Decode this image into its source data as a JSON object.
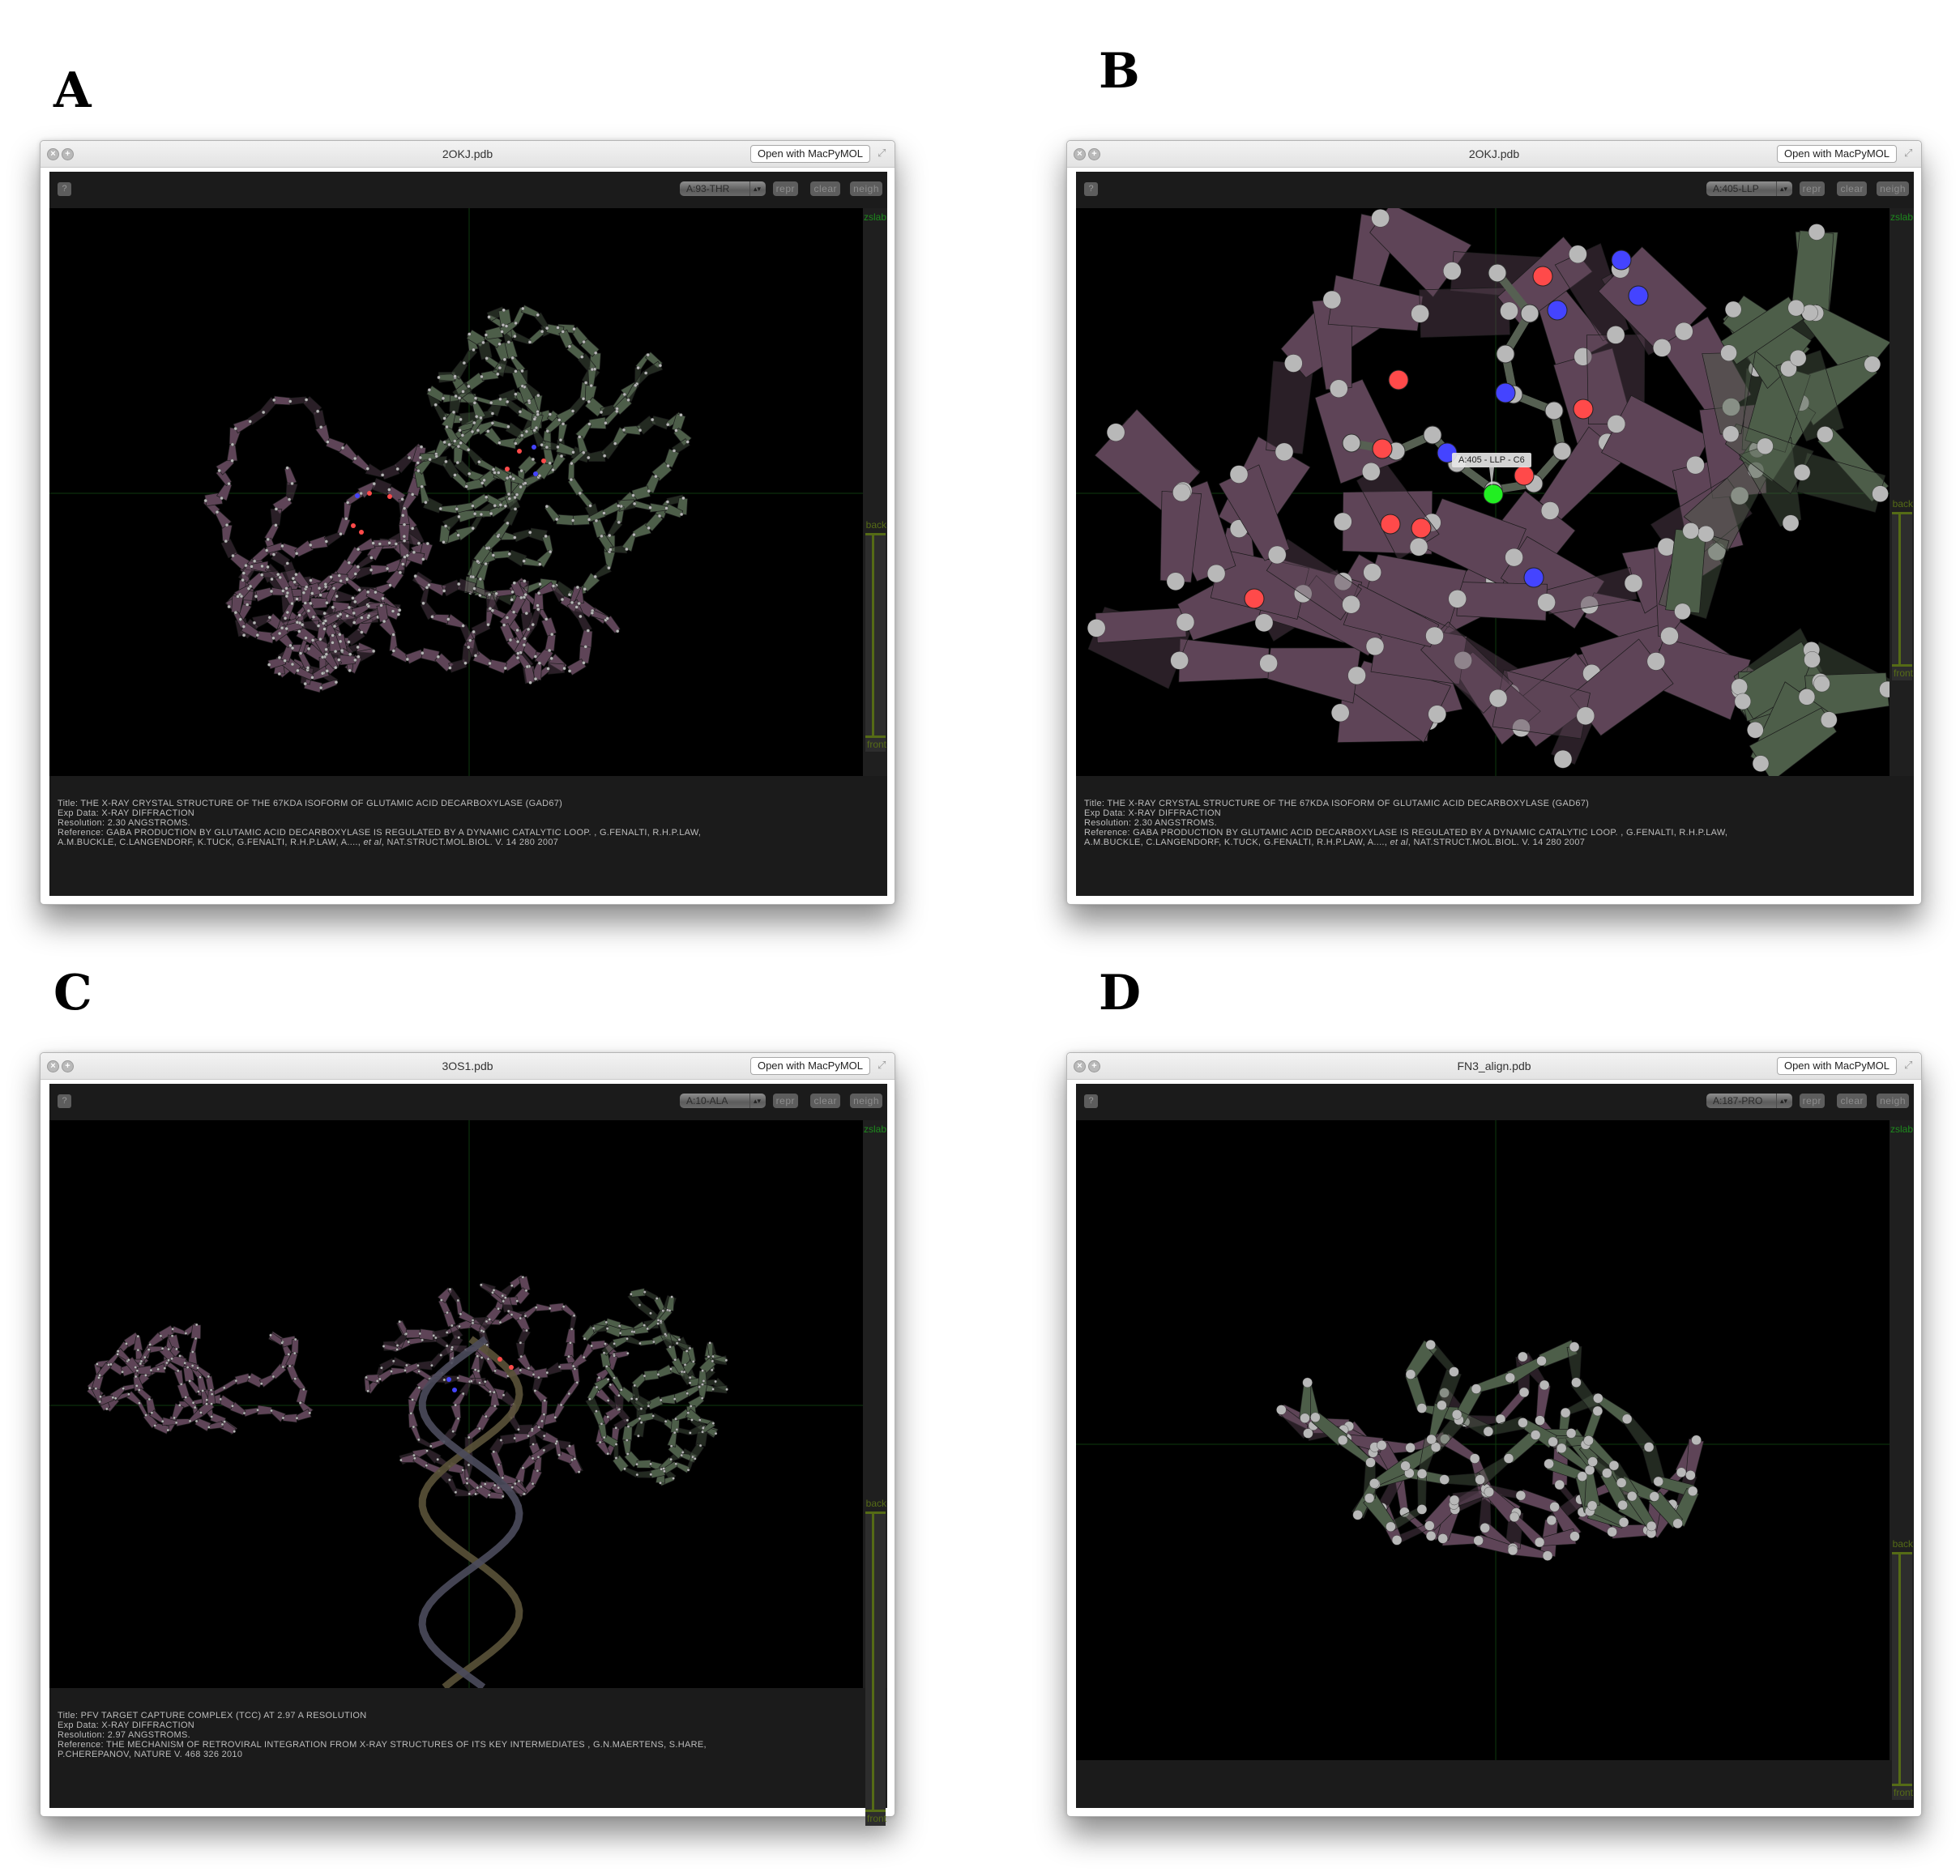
{
  "figure_labels": [
    "A",
    "B",
    "C",
    "D"
  ],
  "colors": {
    "chain_a": "#5e4457",
    "chain_b": "#4d5e49",
    "dna_strand_1": "#5a5238",
    "dna_strand_2": "#4b4b5c",
    "carbon": "#b8b8b8",
    "oxygen": "#ff4a4a",
    "nitrogen": "#4444ff",
    "selected_atom": "#22ee22",
    "zslab_label": "#1d8a1d",
    "zslab_bar": "#556b16"
  },
  "common": {
    "open_button": "Open with MacPyMOL",
    "help_button": "?",
    "repr_button": "repr",
    "clear_button": "clear",
    "neigh_button": "neigh",
    "zslab_label": "zslab",
    "back_label": "back",
    "front_label": "front",
    "close_icon": "×",
    "zoom_icon": "+",
    "expand_icon": "⤢",
    "select_arrows": "▴▾"
  },
  "panels": [
    {
      "label": "A",
      "window_title": "2OKJ.pdb",
      "residue_select": "A:93-THR",
      "view": "full-structure",
      "info": {
        "title": "Title: THE X-RAY CRYSTAL STRUCTURE OF THE 67KDA ISOFORM OF GLUTAMIC ACID DECARBOXYLASE (GAD67)",
        "exp_data": "Exp Data: X-RAY DIFFRACTION",
        "resolution": "Resolution: 2.30 ANGSTROMS.",
        "reference_1": "Reference: GABA PRODUCTION BY GLUTAMIC ACID DECARBOXYLASE IS REGULATED BY A DYNAMIC CATALYTIC LOOP. , G.FENALTI, R.H.P.LAW,",
        "reference_2a": "A.M.BUCKLE, C.LANGENDORF, K.TUCK, G.FENALTI, R.H.P.LAW, A...., ",
        "reference_etal": "et al",
        "reference_2b": ", NAT.STRUCT.MOL.BIOL. V. 14 280 2007"
      }
    },
    {
      "label": "B",
      "window_title": "2OKJ.pdb",
      "residue_select": "A:405-LLP",
      "view": "zoomed-active-site",
      "atom_tooltip": "A:405 - LLP - C6",
      "info": {
        "title": "Title: THE X-RAY CRYSTAL STRUCTURE OF THE 67KDA ISOFORM OF GLUTAMIC ACID DECARBOXYLASE (GAD67)",
        "exp_data": "Exp Data: X-RAY DIFFRACTION",
        "resolution": "Resolution: 2.30 ANGSTROMS.",
        "reference_1": "Reference: GABA PRODUCTION BY GLUTAMIC ACID DECARBOXYLASE IS REGULATED BY A DYNAMIC CATALYTIC LOOP. , G.FENALTI, R.H.P.LAW,",
        "reference_2a": "A.M.BUCKLE, C.LANGENDORF, K.TUCK, G.FENALTI, R.H.P.LAW, A...., ",
        "reference_etal": "et al",
        "reference_2b": ", NAT.STRUCT.MOL.BIOL. V. 14 280 2007"
      }
    },
    {
      "label": "C",
      "window_title": "3OS1.pdb",
      "residue_select": "A:10-ALA",
      "view": "protein-dna-complex",
      "info": {
        "title": "Title: PFV TARGET CAPTURE COMPLEX (TCC) AT 2.97 A RESOLUTION",
        "exp_data": "Exp Data: X-RAY DIFFRACTION",
        "resolution": "Resolution: 2.97 ANGSTROMS.",
        "reference_1": "Reference: THE MECHANISM OF RETROVIRAL INTEGRATION FROM X-RAY STRUCTURES OF ITS KEY INTERMEDIATES , G.N.MAERTENS, S.HARE,",
        "reference_2a": "P.CHEREPANOV, NATURE V. 468 326 2010",
        "reference_etal": "",
        "reference_2b": ""
      }
    },
    {
      "label": "D",
      "window_title": "FN3_align.pdb",
      "residue_select": "A:187-PRO",
      "view": "aligned-backbones",
      "info": null
    }
  ]
}
